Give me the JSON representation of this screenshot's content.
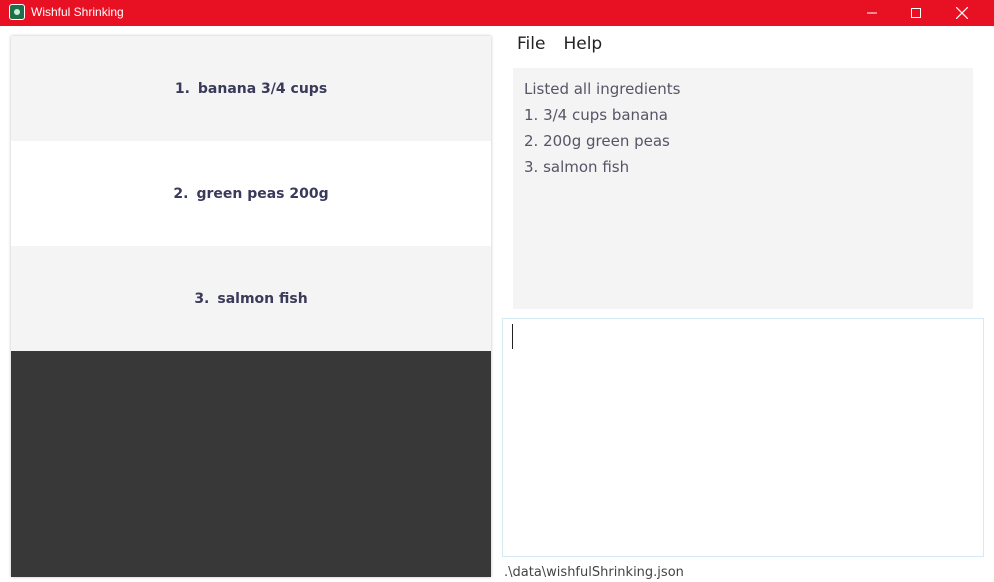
{
  "window": {
    "title": "Wishful Shrinking",
    "accent_color": "#e81123",
    "icons": [
      "app-icon",
      "minimize-icon",
      "maximize-icon",
      "close-icon"
    ]
  },
  "menu": {
    "items": [
      {
        "label": "File"
      },
      {
        "label": "Help"
      }
    ]
  },
  "ingredient_list": {
    "items": [
      {
        "index": "1.",
        "name": "banana 3/4 cups"
      },
      {
        "index": "2.",
        "name": "green peas 200g"
      },
      {
        "index": "3.",
        "name": "salmon fish"
      }
    ]
  },
  "result_display": {
    "lines": [
      "Listed all ingredients",
      "1. 3/4 cups banana",
      "2. 200g green peas",
      "3. salmon fish"
    ]
  },
  "command_box": {
    "value": ""
  },
  "status_bar": {
    "save_location": ".\\data\\wishfulShrinking.json"
  }
}
